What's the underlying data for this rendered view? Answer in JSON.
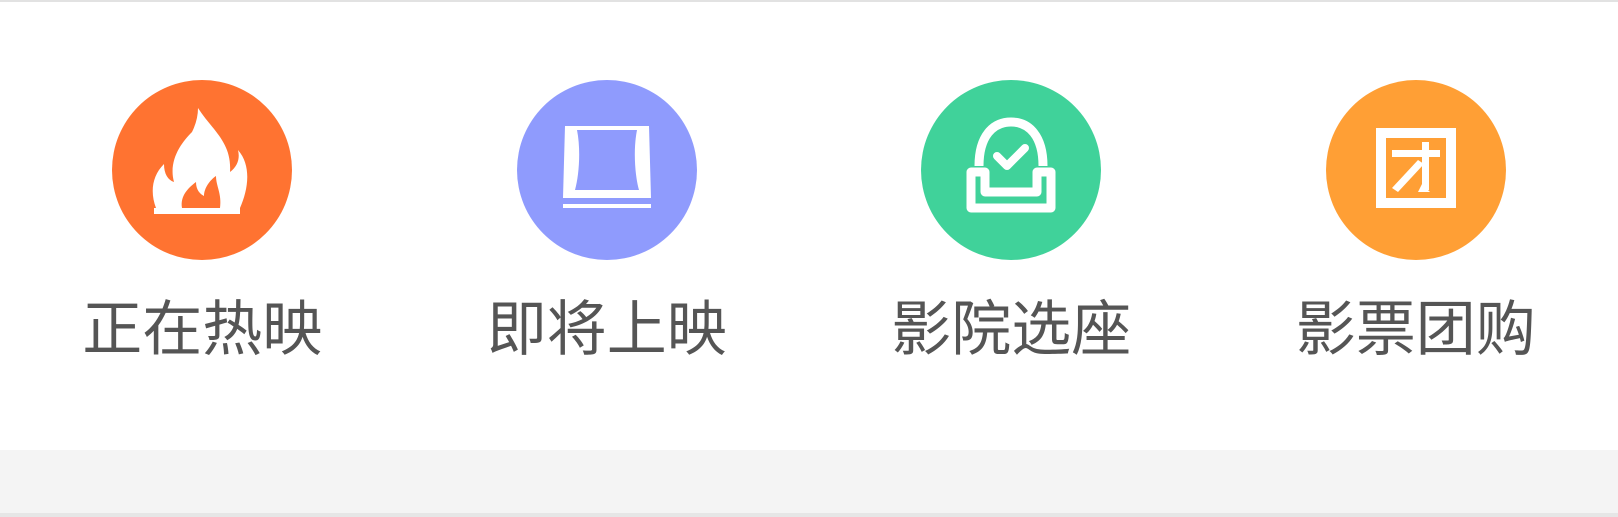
{
  "nav": {
    "items": [
      {
        "label": "正在热映",
        "icon": "fire-icon",
        "color": "#FF7331"
      },
      {
        "label": "即将上映",
        "icon": "screen-icon",
        "color": "#8F9BFD"
      },
      {
        "label": "影院选座",
        "icon": "seat-check-icon",
        "color": "#40D29A"
      },
      {
        "label": "影票团购",
        "icon": "group-buy-icon",
        "color": "#FF9F35"
      }
    ]
  },
  "colors": {
    "label_text": "#555555",
    "background": "#FFFFFF",
    "strip": "#F4F4F4"
  }
}
